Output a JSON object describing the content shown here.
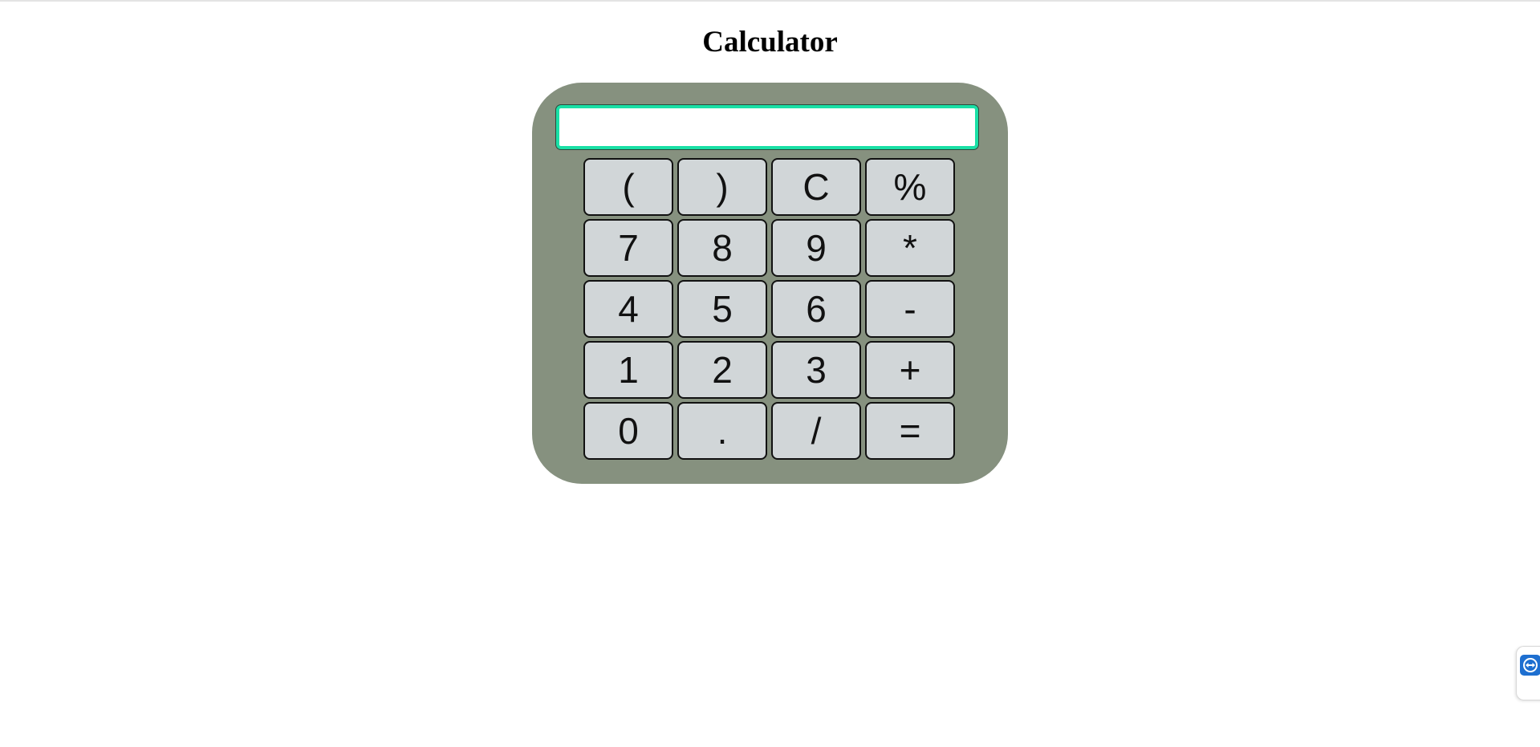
{
  "page": {
    "title": "Calculator"
  },
  "display": {
    "value": "",
    "placeholder": ""
  },
  "keys": [
    {
      "label": "(",
      "name": "open-paren-button"
    },
    {
      "label": ")",
      "name": "close-paren-button"
    },
    {
      "label": "C",
      "name": "clear-button"
    },
    {
      "label": "%",
      "name": "percent-button"
    },
    {
      "label": "7",
      "name": "digit-7-button"
    },
    {
      "label": "8",
      "name": "digit-8-button"
    },
    {
      "label": "9",
      "name": "digit-9-button"
    },
    {
      "label": "*",
      "name": "multiply-button"
    },
    {
      "label": "4",
      "name": "digit-4-button"
    },
    {
      "label": "5",
      "name": "digit-5-button"
    },
    {
      "label": "6",
      "name": "digit-6-button"
    },
    {
      "label": "-",
      "name": "subtract-button"
    },
    {
      "label": "1",
      "name": "digit-1-button"
    },
    {
      "label": "2",
      "name": "digit-2-button"
    },
    {
      "label": "3",
      "name": "digit-3-button"
    },
    {
      "label": "+",
      "name": "add-button"
    },
    {
      "label": "0",
      "name": "digit-0-button"
    },
    {
      "label": ".",
      "name": "decimal-button"
    },
    {
      "label": "/",
      "name": "divide-button"
    },
    {
      "label": "=",
      "name": "equals-button"
    }
  ],
  "colors": {
    "calculator_body": "#86917f",
    "display_border": "#1ae0a6",
    "key_background": "#d1d6d8",
    "widget_accent": "#1e6fd0"
  },
  "icons": {
    "side_widget": "remote-support-icon"
  }
}
